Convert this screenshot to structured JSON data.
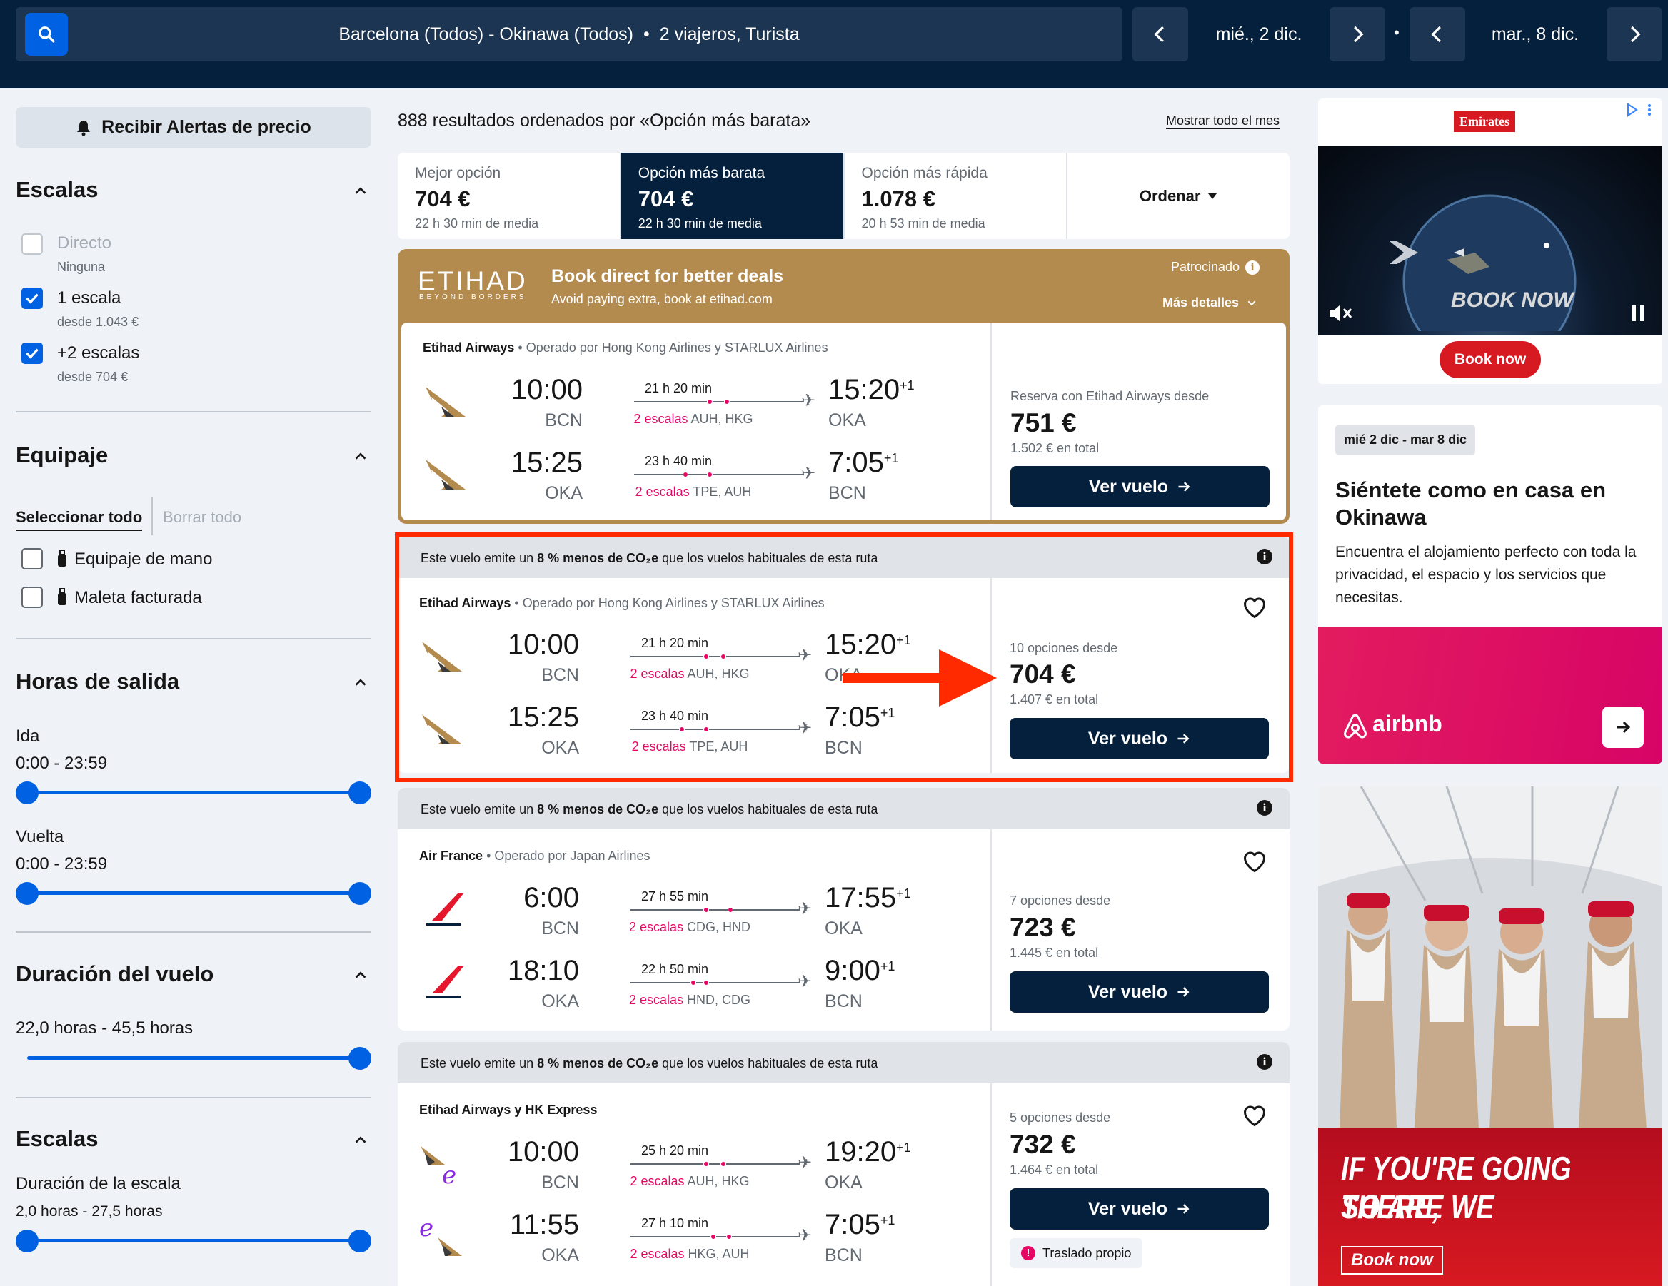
{
  "header": {
    "route": "Barcelona (Todos) - Okinawa (Todos)",
    "separator": "•",
    "travelers": "2 viajeros, Turista",
    "depart_date": "mié., 2 dic.",
    "return_date": "mar., 8 dic.",
    "dot": "•"
  },
  "sidebar": {
    "alert_button": "Recibir Alertas de precio",
    "stops": {
      "title": "Escalas",
      "options": [
        {
          "label": "Directo",
          "sub": "Ninguna",
          "checked": false
        },
        {
          "label": "1 escala",
          "sub": "desde 1.043 €",
          "checked": true
        },
        {
          "label": "+2 escalas",
          "sub": "desde 704 €",
          "checked": true
        }
      ]
    },
    "baggage": {
      "title": "Equipaje",
      "select_all": "Seleccionar todo",
      "clear_all": "Borrar todo",
      "options": [
        "Equipaje de mano",
        "Maleta facturada"
      ]
    },
    "departure_times": {
      "title": "Horas de salida",
      "outbound_label": "Ida",
      "outbound_range": "0:00 - 23:59",
      "return_label": "Vuelta",
      "return_range": "0:00 - 23:59"
    },
    "duration": {
      "title": "Duración del vuelo",
      "range": "22,0 horas - 45,5 horas"
    },
    "layovers": {
      "title": "Escalas",
      "subtitle": "Duración de la escala",
      "range": "2,0 horas - 27,5 horas"
    }
  },
  "results": {
    "summary": "888 resultados ordenados por «Opción más barata»",
    "show_month": "Mostrar todo el mes",
    "tabs": [
      {
        "label": "Mejor opción",
        "price": "704 €",
        "sub": "22 h 30 min de media",
        "selected": false
      },
      {
        "label": "Opción más barata",
        "price": "704 €",
        "sub": "22 h 30 min de media",
        "selected": true
      },
      {
        "label": "Opción más rápida",
        "price": "1.078 €",
        "sub": "20 h 53 min de media",
        "selected": false
      }
    ],
    "sort_label": "Ordenar"
  },
  "sponsored": {
    "brand": "ETIHAD",
    "brand_tagline": "BEYOND BORDERS",
    "headline": "Book direct for better deals",
    "subline": "Avoid paying extra, book at etihad.com",
    "sponsored_label": "Patrocinado",
    "more_details": "Más detalles",
    "airline": "Etihad Airways",
    "operated": "• Operado por Hong Kong Airlines y STARLUX Airlines",
    "legs": [
      {
        "dep_time": "10:00",
        "dep_airport": "BCN",
        "duration": "21 h 20 min",
        "stops": "2 escalas",
        "via": "AUH, HKG",
        "arr_time": "15:20",
        "plus": "+1",
        "arr_airport": "OKA"
      },
      {
        "dep_time": "15:25",
        "dep_airport": "OKA",
        "duration": "23 h 40 min",
        "stops": "2 escalas",
        "via": "TPE, AUH",
        "arr_time": "7:05",
        "plus": "+1",
        "arr_airport": "BCN"
      }
    ],
    "from_label": "Reserva con Etihad Airways desde",
    "price": "751 €",
    "total": "1.502 € en total",
    "cta": "Ver vuelo"
  },
  "cards": [
    {
      "co2_pre": "Este vuelo emite un ",
      "co2_bold": "8 % menos de CO₂e",
      "co2_post": " que los vuelos habituales de esta ruta",
      "airline": "Etihad Airways",
      "operated": "• Operado por Hong Kong Airlines y STARLUX Airlines",
      "legs": [
        {
          "dep_time": "10:00",
          "dep_airport": "BCN",
          "duration": "21 h 20 min",
          "stops": "2 escalas",
          "via": "AUH, HKG",
          "arr_time": "15:20",
          "plus": "+1",
          "arr_airport": "OKA"
        },
        {
          "dep_time": "15:25",
          "dep_airport": "OKA",
          "duration": "23 h 40 min",
          "stops": "2 escalas",
          "via": "TPE, AUH",
          "arr_time": "7:05",
          "plus": "+1",
          "arr_airport": "BCN"
        }
      ],
      "from_label": "10 opciones desde",
      "price": "704 €",
      "total": "1.407 € en total",
      "cta": "Ver vuelo"
    },
    {
      "co2_pre": "Este vuelo emite un ",
      "co2_bold": "8 % menos de CO₂e",
      "co2_post": " que los vuelos habituales de esta ruta",
      "airline": "Air France",
      "operated": "• Operado por Japan Airlines",
      "legs": [
        {
          "dep_time": "6:00",
          "dep_airport": "BCN",
          "duration": "27 h 55 min",
          "stops": "2 escalas",
          "via": "CDG, HND",
          "arr_time": "17:55",
          "plus": "+1",
          "arr_airport": "OKA"
        },
        {
          "dep_time": "18:10",
          "dep_airport": "OKA",
          "duration": "22 h 50 min",
          "stops": "2 escalas",
          "via": "HND, CDG",
          "arr_time": "9:00",
          "plus": "+1",
          "arr_airport": "BCN"
        }
      ],
      "from_label": "7 opciones desde",
      "price": "723 €",
      "total": "1.445 € en total",
      "cta": "Ver vuelo"
    },
    {
      "co2_pre": "Este vuelo emite un ",
      "co2_bold": "8 % menos de CO₂e",
      "co2_post": " que los vuelos habituales de esta ruta",
      "airline": "Etihad Airways y HK Express",
      "operated": "",
      "legs": [
        {
          "dep_time": "10:00",
          "dep_airport": "BCN",
          "duration": "25 h 20 min",
          "stops": "2 escalas",
          "via": "AUH, HKG",
          "arr_time": "19:20",
          "plus": "+1",
          "arr_airport": "OKA"
        },
        {
          "dep_time": "11:55",
          "dep_airport": "OKA",
          "duration": "27 h 10 min",
          "stops": "2 escalas",
          "via": "HKG, AUH",
          "arr_time": "7:05",
          "plus": "+1",
          "arr_airport": "BCN"
        }
      ],
      "from_label": "5 opciones desde",
      "price": "732 €",
      "total": "1.464 € en total",
      "cta": "Ver vuelo",
      "warning": "Traslado propio"
    }
  ],
  "ads": {
    "emirates_top": {
      "brand": "Emirates",
      "video_text": "BOOK NOW",
      "button": "Book now"
    },
    "airbnb": {
      "dates": "mié 2 dic - mar 8 dic",
      "title": "Siéntete como en casa en Okinawa",
      "body": "Encuentra el alojamiento perfecto con toda la privacidad, el espacio y los servicios que necesitas.",
      "brand": "airbnb"
    },
    "emirates_bottom": {
      "headline_1": "IF YOU'RE GOING THERE,",
      "headline_2": "SO ARE WE",
      "button": "Book now"
    }
  },
  "colors": {
    "header_bg": "#05203c",
    "primary_blue": "#0062e3",
    "stops_pink": "#e70866",
    "highlight_red": "#ff2a00",
    "etihad_gold": "#b48b4f",
    "airbnb_pink": "#e31c5f"
  }
}
